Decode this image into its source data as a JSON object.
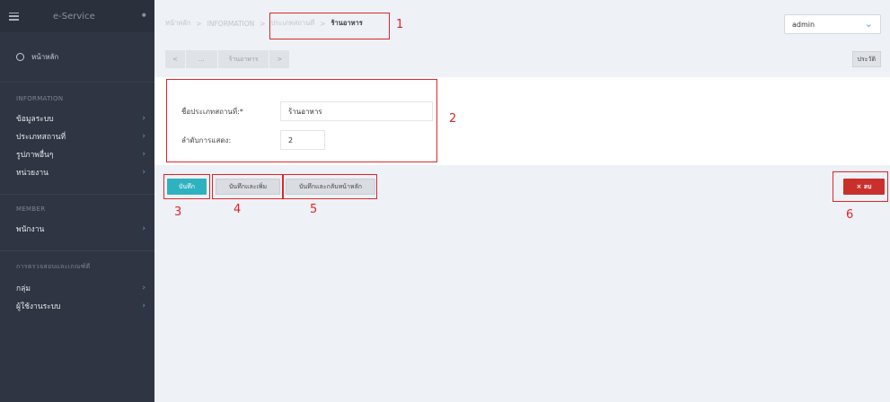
{
  "sidebar": {
    "brand": "e-Service",
    "home": "หน้าหลัก",
    "sections": [
      {
        "heading": "INFORMATION",
        "items": [
          "ข้อมูลระบบ",
          "ประเภทสถานที่",
          "รูปภาพอื่นๆ",
          "หน่วยงาน"
        ]
      },
      {
        "heading": "MEMBER",
        "items": [
          "พนักงาน"
        ]
      },
      {
        "heading": "การตรวจสอบและเกณฑ์ดี",
        "items": [
          "กลุ่ม",
          "ผู้ใช้งานระบบ"
        ]
      }
    ]
  },
  "header": {
    "breadcrumb": [
      "หน้าหลัก",
      "INFORMATION",
      "ประเภทสถานที่",
      "ร้านอาหาร"
    ],
    "user": "admin"
  },
  "tabs": {
    "prev": "<",
    "ellipsis": "...",
    "current": "ร้านอาหาร",
    "next": ">",
    "history": "ประวัติ"
  },
  "form": {
    "name_label": "ชื่อประเภทสถานที่:*",
    "name_value": "ร้านอาหาร",
    "order_label": "ลำดับการแสดง:",
    "order_value": "2"
  },
  "actions": {
    "save": "บันทึก",
    "save_add": "บันทึกและเพิ่ม",
    "save_back": "บันทึกและกลับหน้าหลัก",
    "delete": "× ลบ"
  },
  "annotations": [
    "1",
    "2",
    "3",
    "4",
    "5",
    "6"
  ],
  "colors": {
    "annotation": "#e0262a",
    "save": "#2fb2c0",
    "delete": "#c9302c",
    "sidebar": "#2f3542"
  }
}
